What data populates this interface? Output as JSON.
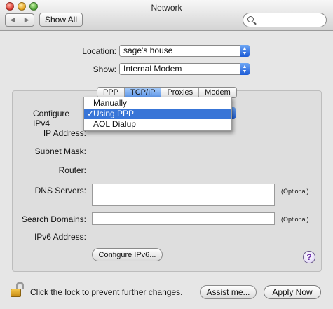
{
  "window": {
    "title": "Network"
  },
  "toolbar": {
    "back_glyph": "◀",
    "forward_glyph": "▶",
    "show_all_label": "Show All",
    "search_placeholder": ""
  },
  "location": {
    "label": "Location:",
    "value": "sage's house"
  },
  "show": {
    "label": "Show:",
    "value": "Internal Modem"
  },
  "tabs": [
    {
      "label": "PPP",
      "selected": false
    },
    {
      "label": "TCP/IP",
      "selected": true
    },
    {
      "label": "Proxies",
      "selected": false
    },
    {
      "label": "Modem",
      "selected": false
    }
  ],
  "form": {
    "configure_label": "Configure IPv4",
    "ip_address_label": "IP Address:",
    "subnet_mask_label": "Subnet Mask:",
    "router_label": "Router:",
    "dns_servers_label": "DNS Servers:",
    "search_domains_label": "Search Domains:",
    "ipv6_address_label": "IPv6 Address:",
    "optional_text": "(Optional)",
    "configure_ipv6_button": "Configure IPv6..."
  },
  "configure_menu": {
    "items": [
      {
        "label": "Manually",
        "checked": false,
        "highlighted": false
      },
      {
        "label": "Using PPP",
        "checked": true,
        "highlighted": true
      },
      {
        "label": "AOL Dialup",
        "checked": false,
        "highlighted": false
      }
    ],
    "check_glyph": "✓"
  },
  "footer": {
    "lock_text": "Click the lock to prevent further changes.",
    "assist_button": "Assist me...",
    "apply_button": "Apply Now",
    "help_glyph": "?"
  },
  "colors": {
    "selection": "#3875d7",
    "tab_active": "#5c95e8"
  }
}
